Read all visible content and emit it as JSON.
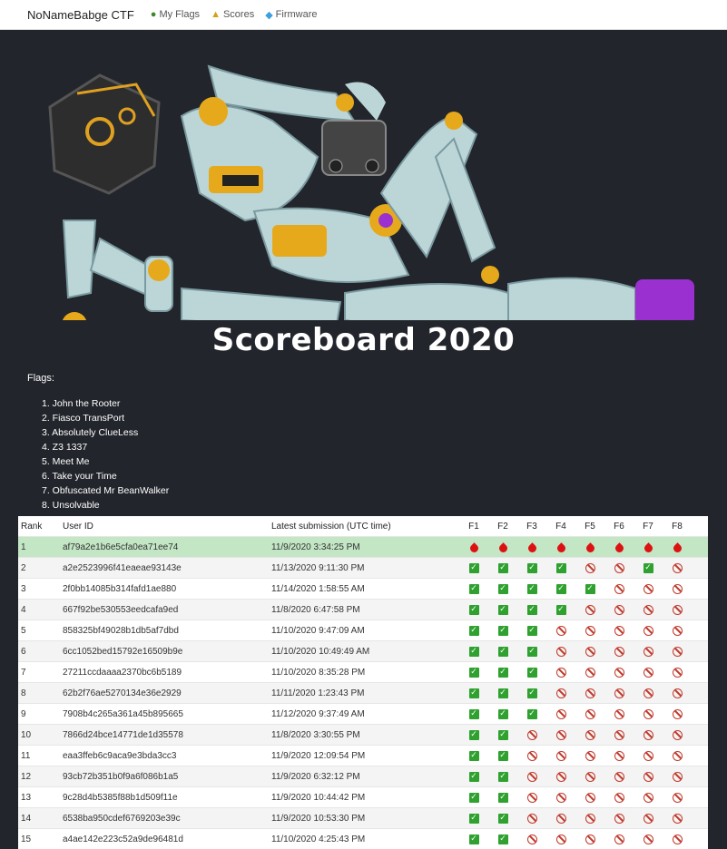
{
  "nav": {
    "brand": "NoNameBabge CTF",
    "items": [
      {
        "label": "My Flags",
        "icon": "money-bag-icon"
      },
      {
        "label": "Scores",
        "icon": "trophy-icon"
      },
      {
        "label": "Firmware",
        "icon": "diamond-icon"
      }
    ]
  },
  "title": "Scoreboard 2020",
  "flags_label": "Flags:",
  "flags": [
    "1. John the Rooter",
    "2. Fiasco TransPort",
    "3. Absolutely ClueLess",
    "4. Z3 1337",
    "5. Meet Me",
    "6. Take your Time",
    "7. Obfuscated Mr BeanWalker",
    "8. Unsolvable"
  ],
  "table": {
    "headers": [
      "Rank",
      "User ID",
      "Latest submission (UTC time)",
      "F1",
      "F2",
      "F3",
      "F4",
      "F5",
      "F6",
      "F7",
      "F8"
    ],
    "rows": [
      {
        "rank": "1",
        "user": "af79a2e1b6e5cfa0ea71ee74",
        "time": "11/9/2020 3:34:25 PM",
        "flags": [
          "blood",
          "blood",
          "blood",
          "blood",
          "blood",
          "blood",
          "blood",
          "blood"
        ]
      },
      {
        "rank": "2",
        "user": "a2e2523996f41eaeae93143e",
        "time": "11/13/2020 9:11:30 PM",
        "flags": [
          "ok",
          "ok",
          "ok",
          "ok",
          "no",
          "no",
          "ok",
          "no"
        ]
      },
      {
        "rank": "3",
        "user": "2f0bb14085b314fafd1ae880",
        "time": "11/14/2020 1:58:55 AM",
        "flags": [
          "ok",
          "ok",
          "ok",
          "ok",
          "ok",
          "no",
          "no",
          "no"
        ]
      },
      {
        "rank": "4",
        "user": "667f92be530553eedcafa9ed",
        "time": "11/8/2020 6:47:58 PM",
        "flags": [
          "ok",
          "ok",
          "ok",
          "ok",
          "no",
          "no",
          "no",
          "no"
        ]
      },
      {
        "rank": "5",
        "user": "858325bf49028b1db5af7dbd",
        "time": "11/10/2020 9:47:09 AM",
        "flags": [
          "ok",
          "ok",
          "ok",
          "no",
          "no",
          "no",
          "no",
          "no"
        ]
      },
      {
        "rank": "6",
        "user": "6cc1052bed15792e16509b9e",
        "time": "11/10/2020 10:49:49 AM",
        "flags": [
          "ok",
          "ok",
          "ok",
          "no",
          "no",
          "no",
          "no",
          "no"
        ]
      },
      {
        "rank": "7",
        "user": "27211ccdaaaa2370bc6b5189",
        "time": "11/10/2020 8:35:28 PM",
        "flags": [
          "ok",
          "ok",
          "ok",
          "no",
          "no",
          "no",
          "no",
          "no"
        ]
      },
      {
        "rank": "8",
        "user": "62b2f76ae5270134e36e2929",
        "time": "11/11/2020 1:23:43 PM",
        "flags": [
          "ok",
          "ok",
          "ok",
          "no",
          "no",
          "no",
          "no",
          "no"
        ]
      },
      {
        "rank": "9",
        "user": "7908b4c265a361a45b895665",
        "time": "11/12/2020 9:37:49 AM",
        "flags": [
          "ok",
          "ok",
          "ok",
          "no",
          "no",
          "no",
          "no",
          "no"
        ]
      },
      {
        "rank": "10",
        "user": "7866d24bce14771de1d35578",
        "time": "11/8/2020 3:30:55 PM",
        "flags": [
          "ok",
          "ok",
          "no",
          "no",
          "no",
          "no",
          "no",
          "no"
        ]
      },
      {
        "rank": "11",
        "user": "eaa3ffeb6c9aca9e3bda3cc3",
        "time": "11/9/2020 12:09:54 PM",
        "flags": [
          "ok",
          "ok",
          "no",
          "no",
          "no",
          "no",
          "no",
          "no"
        ]
      },
      {
        "rank": "12",
        "user": "93cb72b351b0f9a6f086b1a5",
        "time": "11/9/2020 6:32:12 PM",
        "flags": [
          "ok",
          "ok",
          "no",
          "no",
          "no",
          "no",
          "no",
          "no"
        ]
      },
      {
        "rank": "13",
        "user": "9c28d4b5385f88b1d509f11e",
        "time": "11/9/2020 10:44:42 PM",
        "flags": [
          "ok",
          "ok",
          "no",
          "no",
          "no",
          "no",
          "no",
          "no"
        ]
      },
      {
        "rank": "14",
        "user": "6538ba950cdef6769203e39c",
        "time": "11/9/2020 10:53:30 PM",
        "flags": [
          "ok",
          "ok",
          "no",
          "no",
          "no",
          "no",
          "no",
          "no"
        ]
      },
      {
        "rank": "15",
        "user": "a4ae142e223c52a9de96481d",
        "time": "11/10/2020 4:25:43 PM",
        "flags": [
          "ok",
          "ok",
          "no",
          "no",
          "no",
          "no",
          "no",
          "no"
        ]
      }
    ]
  }
}
